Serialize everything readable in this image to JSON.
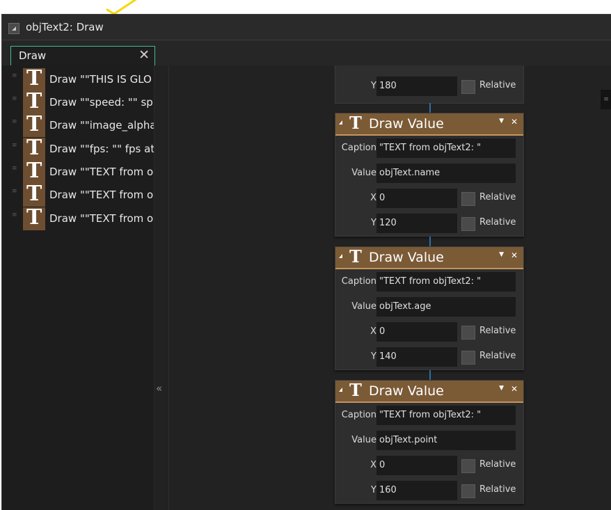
{
  "window": {
    "title": "objText2: Draw"
  },
  "tab": {
    "label": "Draw",
    "close": "✕"
  },
  "actions": [
    {
      "text": "Draw \"\"THIS IS GLO"
    },
    {
      "text": "Draw \"\"speed: \"\" sp"
    },
    {
      "text": "Draw \"\"image_alpha"
    },
    {
      "text": "Draw \"\"fps: \"\" fps at"
    },
    {
      "text": "Draw \"\"TEXT from o"
    },
    {
      "text": "Draw \"\"TEXT from o"
    },
    {
      "text": "Draw \"\"TEXT from o"
    }
  ],
  "collapse_glyph": "«",
  "top_partial": {
    "y_label": "Y",
    "y_value": "180",
    "relative": "Relative"
  },
  "panels": [
    {
      "title": "Draw Value",
      "caption_label": "Caption",
      "caption": "\"TEXT from objText2: \"",
      "value_label": "Value",
      "value": "objText.name",
      "x_label": "X",
      "x": "0",
      "y_label": "Y",
      "y": "120",
      "relative": "Relative"
    },
    {
      "title": "Draw Value",
      "caption_label": "Caption",
      "caption": "\"TEXT from objText2: \"",
      "value_label": "Value",
      "value": "objText.age",
      "x_label": "X",
      "x": "0",
      "y_label": "Y",
      "y": "140",
      "relative": "Relative"
    },
    {
      "title": "Draw Value",
      "caption_label": "Caption",
      "caption": "\"TEXT from objText2: \"",
      "value_label": "Value",
      "value": "objText.point",
      "x_label": "X",
      "x": "0",
      "y_label": "Y",
      "y": "160",
      "relative": "Relative"
    }
  ],
  "colors": {
    "accent_tab": "#3fbf8f",
    "panel_header": "#7b5a36",
    "connector": "#2d6ea8",
    "annotation_check": "#f5d800"
  }
}
